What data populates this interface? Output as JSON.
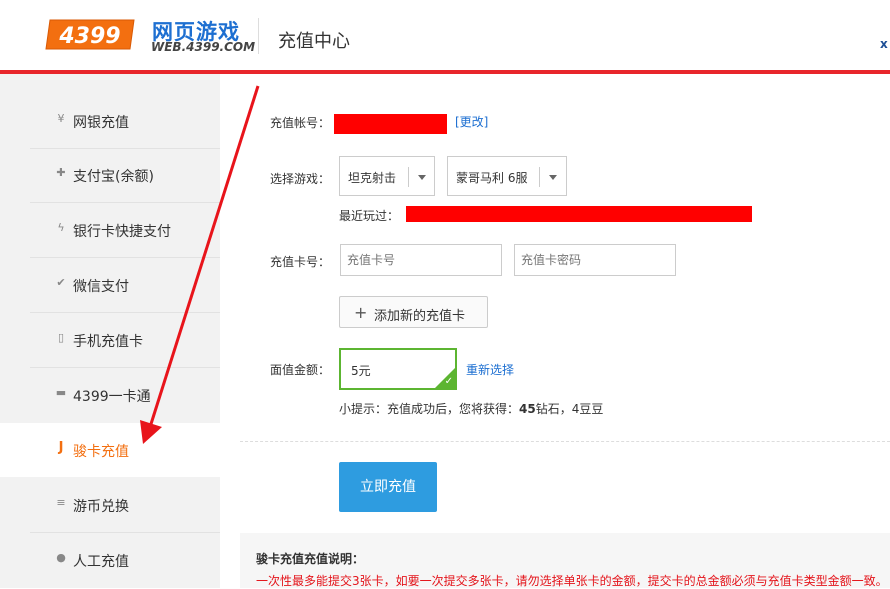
{
  "header": {
    "logo_number": "4399",
    "logo_cn": "网页游戏",
    "logo_web": "WEB.4399.COM",
    "title": "充值中心",
    "user_partial": "x"
  },
  "sidebar": {
    "items": [
      {
        "icon": "yen-icon",
        "glyph": "¥",
        "label": "网银充值"
      },
      {
        "icon": "alipay-icon",
        "glyph": "✚",
        "label": "支付宝(余额)"
      },
      {
        "icon": "lightning-icon",
        "glyph": "ϟ",
        "label": "银行卡快捷支付"
      },
      {
        "icon": "wechat-icon",
        "glyph": "✔",
        "label": "微信支付"
      },
      {
        "icon": "phone-icon",
        "glyph": "▯",
        "label": "手机充值卡"
      },
      {
        "icon": "card-icon",
        "glyph": "▬",
        "label": "4399一卡通"
      },
      {
        "icon": "junka-icon",
        "glyph": "J",
        "label": "骏卡充值",
        "active": true
      },
      {
        "icon": "coins-icon",
        "glyph": "≡",
        "label": "游币兑换"
      },
      {
        "icon": "person-icon",
        "glyph": "●",
        "label": "人工充值"
      }
    ]
  },
  "form": {
    "account_label": "充值帐号：",
    "change_link": "[更改]",
    "game_label": "选择游戏：",
    "game_value": "坦克射击",
    "server_value": "蒙哥马利 6服",
    "recent_label": "最近玩过：",
    "card_label": "充值卡号：",
    "card_number_placeholder": "充值卡号",
    "card_password_placeholder": "充值卡密码",
    "add_card_label": "添加新的充值卡",
    "amount_label": "面值金额：",
    "amount_value": "5元",
    "reselect_link": "重新选择",
    "tip_prefix": "小提示：充值成功后，您将获得：",
    "tip_diamonds": "45",
    "tip_diamonds_unit": "钻石，",
    "tip_beans": "4豆豆",
    "submit_label": "立即充值"
  },
  "notes": {
    "title": "骏卡充值充值说明：",
    "text": "一次性最多能提交3张卡，如要一次提交多张卡，请勿选择单张卡的金额，提交卡的总金额必须与充值卡类型金额一致。"
  },
  "colors": {
    "brand_red": "#e8262b",
    "active_orange": "#f36f10",
    "link_blue": "#1d6fd1",
    "submit_blue": "#2e9ce0",
    "selected_green": "#5cb531",
    "redaction": "#ff0000"
  }
}
